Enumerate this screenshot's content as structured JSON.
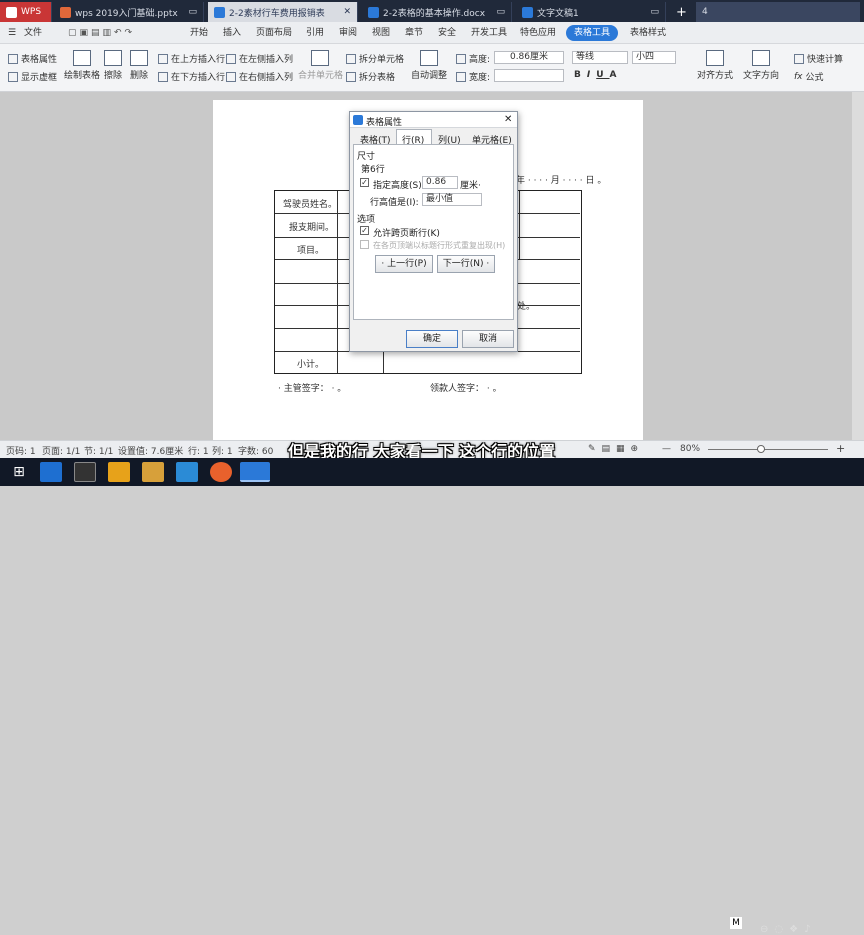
{
  "tabs": [
    {
      "label": "WPS",
      "color": "#d23b3b"
    },
    {
      "label": "wps 2019入门基础.pptx",
      "color": "#e0683a"
    },
    {
      "label": "2-2素材行车费用报销表",
      "color": "#2b79d8"
    },
    {
      "label": "2-2表格的基本操作.docx",
      "color": "#2b79d8"
    },
    {
      "label": "文字文稿1",
      "color": "#2b79d8"
    }
  ],
  "tab_plus": "+",
  "tab_extra": "4",
  "menus": {
    "file": "文件",
    "items": [
      "开始",
      "插入",
      "页面布局",
      "引用",
      "审阅",
      "视图",
      "章节",
      "安全",
      "开发工具",
      "特色应用"
    ],
    "active": "表格工具",
    "last": "表格样式"
  },
  "ribbon": {
    "table_props": "表格属性",
    "show_dashed": "显示虚框",
    "draw_table": "绘制表格",
    "erase": "擦除",
    "delete": "删除",
    "insert_above": "在上方插入行",
    "insert_below": "在下方插入行",
    "insert_left": "在左侧插入列",
    "insert_right": "在右侧插入列",
    "merge_cells": "合并单元格",
    "split_cells": "拆分单元格",
    "split_table": "拆分表格",
    "auto_fit": "自动调整",
    "height_label": "高度:",
    "height_value": "0.86厘米",
    "width_label": "宽度:",
    "font_name": "等线",
    "font_size": "小四",
    "align": "对齐方式",
    "text_dir": "文字方向",
    "quick_calc": "快速计算",
    "formula": "公式"
  },
  "document": {
    "date_text": "年 · · · · 月 · · · · 日 。",
    "driver_name": "驾驶员姓名。",
    "period": "报支期间。",
    "item": "项目。",
    "subtotal": "小计。",
    "place_text": "处。",
    "supervisor": "· 主管签字： · 。",
    "receiver": "领款人签字： · 。"
  },
  "dialog": {
    "title": "表格属性",
    "tabs": [
      "表格(T)",
      "行(R)",
      "列(U)",
      "单元格(E)"
    ],
    "section_size": "尺寸",
    "row_label": "第6行",
    "specify_height": "指定高度(S):",
    "height_value": "0.86",
    "unit": "厘米·",
    "row_height_is": "行高值是(I):",
    "row_height_mode": "最小值",
    "section_options": "选项",
    "allow_break": "允许跨页断行(K)",
    "repeat_header": "在各页顶端以标题行形式重复出现(H)",
    "prev_row": "· 上一行(P)",
    "next_row": "下一行(N) ·",
    "ok": "确定",
    "cancel": "取消"
  },
  "status": {
    "page": "页码: 1",
    "pages": "页面: 1/1",
    "section": "节: 1/1",
    "setting": "设置值: 7.6厘米",
    "row": "行: 1",
    "col": "列: 1",
    "words": "字数: 60",
    "zoom": "80%"
  },
  "subtitle": "但是我的行 大家看一下 这个行的位置",
  "taskbar": {
    "ime": "M",
    "app_colors": [
      "#1e6fd1",
      "#333",
      "#e7a21a",
      "#d7a03a",
      "#2b8bd6",
      "#e8612c",
      "#2b79d8"
    ]
  }
}
